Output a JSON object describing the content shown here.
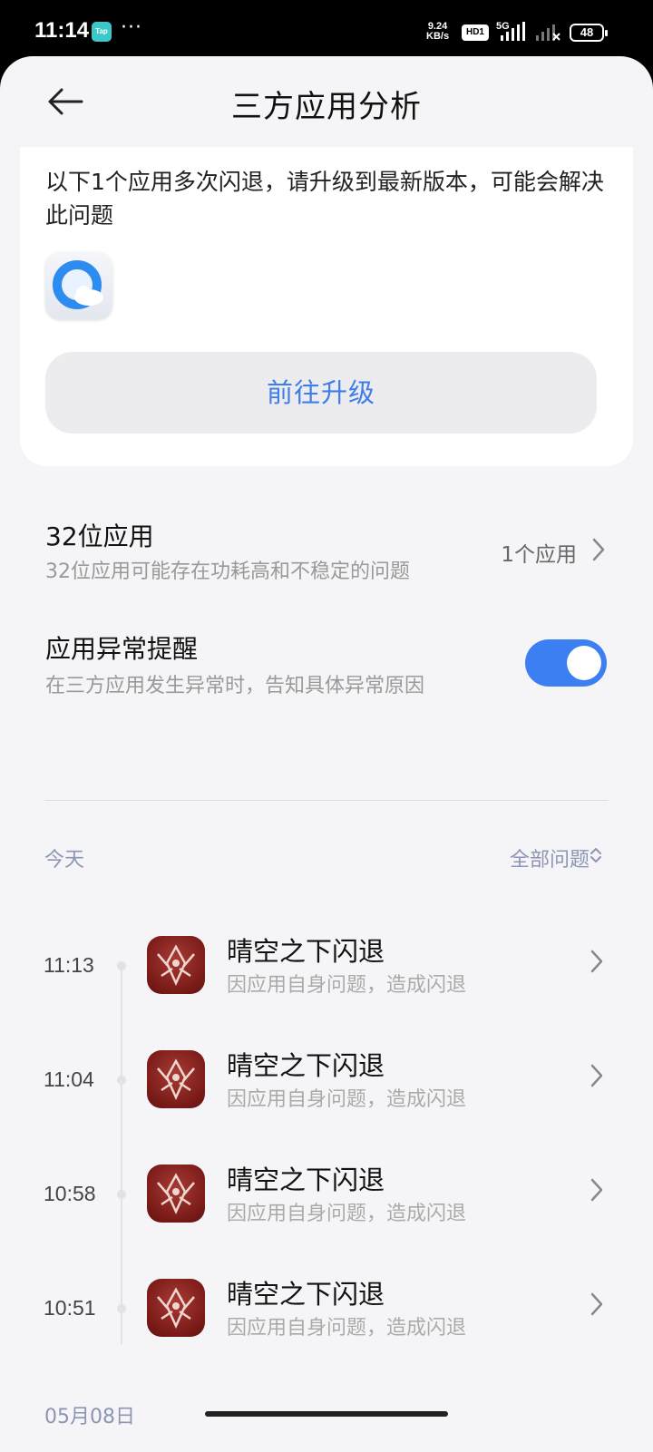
{
  "status_bar": {
    "time": "11:14",
    "tap_badge": "Tap",
    "more": "···",
    "speed_value": "9.24",
    "speed_unit": "KB/s",
    "hd": "HD1",
    "network": "5G",
    "battery": "48"
  },
  "header": {
    "title": "三方应用分析"
  },
  "crash_card": {
    "message": "以下1个应用多次闪退，请升级到最新版本，可能会解决此问题",
    "upgrade_label": "前往升级"
  },
  "row_32bit": {
    "title": "32位应用",
    "subtitle": "32位应用可能存在功耗高和不稳定的问题",
    "value": "1个应用"
  },
  "row_alert": {
    "title": "应用异常提醒",
    "subtitle": "在三方应用发生异常时，告知具体异常原因",
    "toggle_on": true
  },
  "timeline": {
    "today_label": "今天",
    "filter_label": "全部问题",
    "events": [
      {
        "time": "11:13",
        "title": "晴空之下闪退",
        "subtitle": "因应用自身问题，造成闪退"
      },
      {
        "time": "11:04",
        "title": "晴空之下闪退",
        "subtitle": "因应用自身问题，造成闪退"
      },
      {
        "time": "10:58",
        "title": "晴空之下闪退",
        "subtitle": "因应用自身问题，造成闪退"
      },
      {
        "time": "10:51",
        "title": "晴空之下闪退",
        "subtitle": "因应用自身问题，造成闪退"
      }
    ],
    "next_date_label": "05月08日"
  },
  "colors": {
    "accent": "#3f7ee8",
    "toggle": "#3b7ff2",
    "muted_label": "#8d95b5"
  }
}
